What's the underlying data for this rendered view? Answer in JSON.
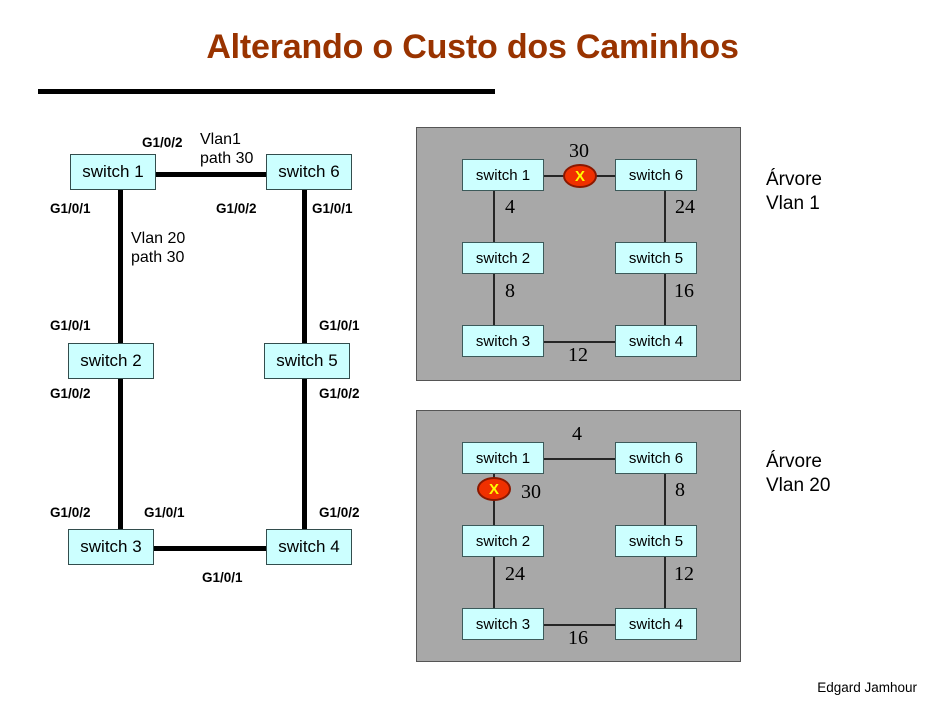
{
  "slide": {
    "title": "Alterando o Custo dos Caminhos",
    "footer_credit": "Edgard Jamhour",
    "accent_color": "#993300",
    "switch_fill": "#ccffff",
    "panel_fill": "#a8a8a8",
    "block_marker_color": "#f03000",
    "block_marker_glyph": "X"
  },
  "topology": {
    "nodes": [
      {
        "id": "sw1",
        "label": "switch 1"
      },
      {
        "id": "sw6",
        "label": "switch 6"
      },
      {
        "id": "sw2",
        "label": "switch 2"
      },
      {
        "id": "sw5",
        "label": "switch 5"
      },
      {
        "id": "sw3",
        "label": "switch 3"
      },
      {
        "id": "sw4",
        "label": "switch 4"
      }
    ],
    "port_labels": [
      {
        "id": "p_sw1_top",
        "text": "G1/0/2"
      },
      {
        "id": "p_sw1_left",
        "text": "G1/0/1"
      },
      {
        "id": "p_sw6_left",
        "text": "G1/0/2"
      },
      {
        "id": "p_sw6_right",
        "text": "G1/0/1"
      },
      {
        "id": "p_sw2_top",
        "text": "G1/0/1"
      },
      {
        "id": "p_sw2_bottom",
        "text": "G1/0/2"
      },
      {
        "id": "p_sw5_top",
        "text": "G1/0/1"
      },
      {
        "id": "p_sw5_bottom",
        "text": "G1/0/2"
      },
      {
        "id": "p_sw3_top",
        "text": "G1/0/2"
      },
      {
        "id": "p_sw3_right",
        "text": "G1/0/1"
      },
      {
        "id": "p_sw4_top",
        "text": "G1/0/2"
      },
      {
        "id": "p_sw4_bottom",
        "text": "G1/0/1"
      }
    ],
    "annotations": {
      "vlan1_line1": "Vlan1",
      "vlan1_line2": "path 30",
      "vlan20_line1": "Vlan 20",
      "vlan20_line2": "path 30"
    }
  },
  "chart_data": {
    "type": "diagram",
    "title": "Alterando o Custo dos Caminhos",
    "trees": [
      {
        "id": "vlan1",
        "caption_line1": "Árvore",
        "caption_line2": "Vlan 1",
        "nodes": [
          "switch 1",
          "switch 6",
          "switch 2",
          "switch 5",
          "switch 3",
          "switch 4"
        ],
        "edges": [
          {
            "from": "switch 1",
            "to": "switch 6",
            "cost": "30",
            "blocked": true
          },
          {
            "from": "switch 1",
            "to": "switch 2",
            "cost": "4",
            "blocked": false
          },
          {
            "from": "switch 6",
            "to": "switch 5",
            "cost": "24",
            "blocked": false
          },
          {
            "from": "switch 2",
            "to": "switch 3",
            "cost": "8",
            "blocked": false
          },
          {
            "from": "switch 5",
            "to": "switch 4",
            "cost": "16",
            "blocked": false
          },
          {
            "from": "switch 3",
            "to": "switch 4",
            "cost": "12",
            "blocked": false
          }
        ]
      },
      {
        "id": "vlan20",
        "caption_line1": "Árvore",
        "caption_line2": "Vlan 20",
        "nodes": [
          "switch 1",
          "switch 6",
          "switch 2",
          "switch 5",
          "switch 3",
          "switch 4"
        ],
        "edges": [
          {
            "from": "switch 1",
            "to": "switch 6",
            "cost": "4",
            "blocked": false
          },
          {
            "from": "switch 1",
            "to": "switch 2",
            "cost": "30",
            "blocked": true
          },
          {
            "from": "switch 6",
            "to": "switch 5",
            "cost": "8",
            "blocked": false
          },
          {
            "from": "switch 2",
            "to": "switch 3",
            "cost": "24",
            "blocked": false
          },
          {
            "from": "switch 5",
            "to": "switch 4",
            "cost": "12",
            "blocked": false
          },
          {
            "from": "switch 3",
            "to": "switch 4",
            "cost": "16",
            "blocked": false
          }
        ]
      }
    ]
  }
}
